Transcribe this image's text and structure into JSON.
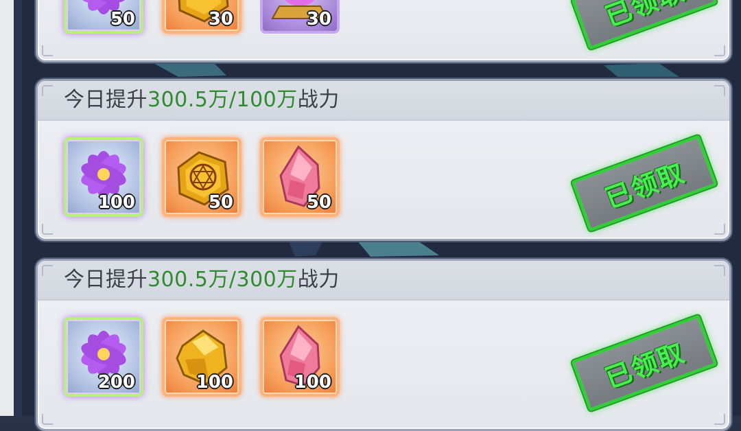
{
  "rows": [
    {
      "title_prefix": "",
      "title_value": "",
      "title_suffix": "",
      "items": [
        {
          "icon": "purple-flower-icon",
          "qty": "50",
          "rarity": "green"
        },
        {
          "icon": "gold-rune-stone-icon",
          "qty": "30",
          "rarity": "orange"
        },
        {
          "icon": "crystal-ball-icon",
          "qty": "30",
          "rarity": "purple"
        }
      ],
      "stamp": "已领取"
    },
    {
      "title_prefix": "今日提升",
      "title_value": "300.5万/100万",
      "title_suffix": "战力",
      "items": [
        {
          "icon": "purple-flower-icon",
          "qty": "100",
          "rarity": "green"
        },
        {
          "icon": "gold-rune-stone-icon",
          "qty": "50",
          "rarity": "orange"
        },
        {
          "icon": "pink-crystal-icon",
          "qty": "50",
          "rarity": "orange"
        }
      ],
      "stamp": "已领取"
    },
    {
      "title_prefix": "今日提升",
      "title_value": "300.5万/300万",
      "title_suffix": "战力",
      "items": [
        {
          "icon": "purple-flower-icon",
          "qty": "200",
          "rarity": "green"
        },
        {
          "icon": "gold-ore-icon",
          "qty": "100",
          "rarity": "orange"
        },
        {
          "icon": "pink-crystal-icon",
          "qty": "100",
          "rarity": "orange"
        }
      ],
      "stamp": "已领取"
    }
  ],
  "colors": {
    "highlight": "#2e8b2f",
    "stamp_green": "#48f04f",
    "card_bg": "#e4e7ec"
  }
}
